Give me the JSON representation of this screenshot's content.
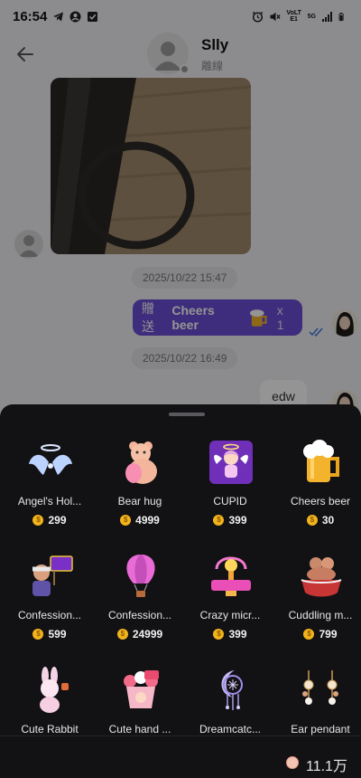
{
  "status_bar": {
    "time": "16:54",
    "network_label_1": "VoLTE1",
    "network_label_2": "5G"
  },
  "header": {
    "contact_name": "Slly",
    "presence": "離線"
  },
  "messages": {
    "timestamp_1": "2025/10/22 15:47",
    "gift_send_verb": "贈送",
    "gift_name": "Cheers beer",
    "gift_quantity": "x 1",
    "timestamp_2": "2025/10/22 16:49",
    "text_reply": "edw"
  },
  "gift_panel": {
    "gifts": [
      {
        "name": "Angel's Hol...",
        "price": "299"
      },
      {
        "name": "Bear hug",
        "price": "4999"
      },
      {
        "name": "CUPID",
        "price": "399"
      },
      {
        "name": "Cheers beer",
        "price": "30"
      },
      {
        "name": "Confession...",
        "price": "599"
      },
      {
        "name": "Confession...",
        "price": "24999"
      },
      {
        "name": "Crazy micr...",
        "price": "399"
      },
      {
        "name": "Cuddling m...",
        "price": "799"
      },
      {
        "name": "Cute Rabbit",
        "price": ""
      },
      {
        "name": "Cute hand ...",
        "price": ""
      },
      {
        "name": "Dreamcatc...",
        "price": ""
      },
      {
        "name": "Ear pendant",
        "price": ""
      }
    ],
    "balance": "11.1万"
  },
  "colors": {
    "gift_bubble": "#6a4fd6",
    "sheet_background": "#121114",
    "coin": "#f2b41c"
  }
}
